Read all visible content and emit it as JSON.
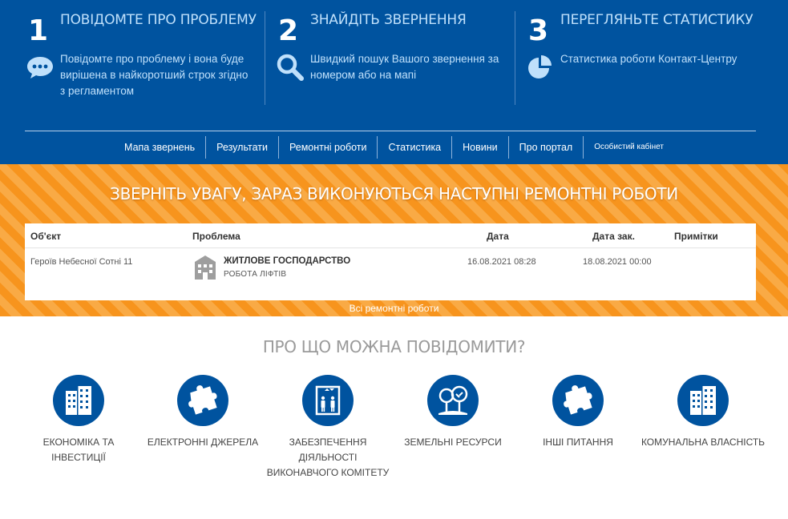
{
  "header": {
    "steps": [
      {
        "number": "1",
        "title": "ПОВІДОМТЕ ПРО ПРОБЛЕМУ",
        "text": "Повідомте про проблему і вона буде вирішена в найкоротший строк згідно з регламентом",
        "icon": "speech-bubble-icon"
      },
      {
        "number": "2",
        "title": "ЗНАЙДІТЬ ЗВЕРНЕННЯ",
        "text": "Швидкий пошук Вашого звернення за номером або на мапі",
        "icon": "search-icon"
      },
      {
        "number": "3",
        "title": "ПЕРЕГЛЯНЬТЕ СТАТИСТИКУ",
        "text": "Статистика роботи Контакт-Центру",
        "icon": "pie-chart-icon"
      }
    ],
    "colors": {
      "background": "#00539f",
      "text": "#bfe0fb"
    }
  },
  "nav": {
    "items": [
      "Мапа звернень",
      "Результати",
      "Ремонтні роботи",
      "Статистика",
      "Новини",
      "Про портал",
      "Особистий кабінет"
    ]
  },
  "repairs": {
    "title": "ЗВЕРНІТЬ УВАГУ, ЗАРАЗ ВИКОНУЮТЬСЯ НАСТУПНІ РЕМОНТНІ РОБОТИ",
    "columns": [
      "Об'єкт",
      "Проблема",
      "Дата",
      "Дата зак.",
      "Примітки"
    ],
    "rows": [
      {
        "object": "Героїв Небесної Сотні 11",
        "problem_title": "ЖИТЛОВЕ ГОСПОДАРСТВО",
        "problem_sub": "РОБОТА ЛІФТІВ",
        "problem_icon": "apartment-building-icon",
        "date": "16.08.2021 08:28",
        "date_end": "18.08.2021 00:00",
        "notes": ""
      }
    ],
    "all_link": "Всі ремонтні роботи",
    "colors": {
      "stripe_dark": "#f7941d",
      "stripe_light": "#f9aa45"
    }
  },
  "categories": {
    "heading": "ПРО ЩО МОЖНА ПОВІДОМИТИ?",
    "items": [
      {
        "label": "Економіка та інвестиції",
        "icon": "buildings-icon"
      },
      {
        "label": "Електронні джерела",
        "icon": "puzzle-icon"
      },
      {
        "label": "Забезпечення діяльності виконавчого комітету",
        "icon": "elevator-icon"
      },
      {
        "label": "Земельні ресурси",
        "icon": "trees-icon"
      },
      {
        "label": "Інші питання",
        "icon": "puzzle-icon"
      },
      {
        "label": "Комунальна власність",
        "icon": "buildings-icon"
      }
    ]
  }
}
